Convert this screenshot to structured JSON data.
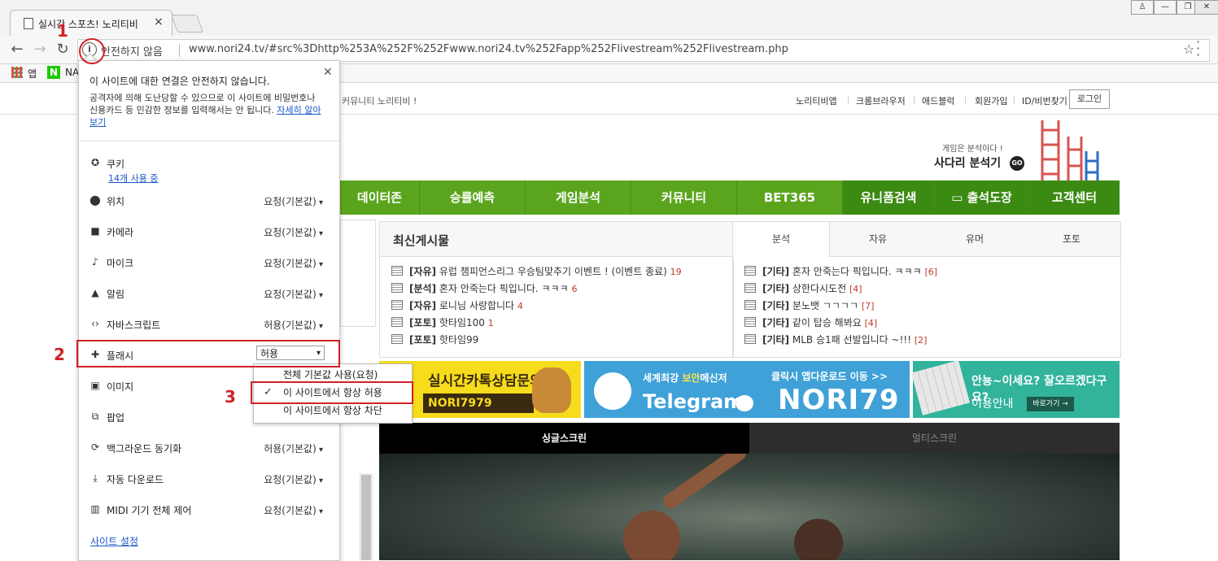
{
  "browser": {
    "tab_title": "실시간 스포츠! 노리티비",
    "tab_close": "×",
    "window_buttons": [
      "♙",
      "—",
      "❐",
      "✕"
    ],
    "security_label": "안전하지 않음",
    "url": "www.nori24.tv/#src%3Dhttp%253A%252F%252Fwww.nori24.tv%252Fapp%252Flivestream%252Flivestream.php",
    "bookmarks": [
      {
        "label": "앱",
        "icon": "apps-grid-icon"
      },
      {
        "label": "NA",
        "icon": "naver-icon"
      }
    ]
  },
  "popup": {
    "title": "이 사이트에 대한 연결은 안전하지 않습니다.",
    "description": "공격자에 의해 도난당할 수 있으므로 이 사이트에 비밀번호나 신용카드 등 민감한 정보를 입력해서는 안 됩니다.",
    "learn_more": "자세히 알아보기",
    "cookie": {
      "label": "쿠키",
      "link": "14개 사용 중"
    },
    "permissions": [
      {
        "label": "위치",
        "value": "요청(기본값)",
        "icon": "location-icon"
      },
      {
        "label": "카메라",
        "value": "요청(기본값)",
        "icon": "camera-icon"
      },
      {
        "label": "마이크",
        "value": "요청(기본값)",
        "icon": "microphone-icon"
      },
      {
        "label": "알림",
        "value": "요청(기본값)",
        "icon": "bell-icon"
      },
      {
        "label": "자바스크립트",
        "value": "허용(기본값)",
        "icon": "code-icon"
      },
      {
        "label": "플래시",
        "value": "허용",
        "icon": "puzzle-icon"
      },
      {
        "label": "이미지",
        "value": "",
        "icon": "image-icon"
      },
      {
        "label": "팝업",
        "value": "",
        "icon": "popup-blocked-icon"
      },
      {
        "label": "백그라운드 동기화",
        "value": "허용(기본값)",
        "icon": "sync-icon"
      },
      {
        "label": "자동 다운로드",
        "value": "요청(기본값)",
        "icon": "download-icon"
      },
      {
        "label": "MIDI 기기 전체 제어",
        "value": "요청(기본값)",
        "icon": "midi-icon"
      }
    ],
    "flash_options": [
      "전체 기본값 사용(요청)",
      "이 사이트에서 항상 허용",
      "이 사이트에서 항상 차단"
    ],
    "flash_selected_index": 1,
    "site_settings": "사이트 설정"
  },
  "annotations": [
    "1",
    "2",
    "3"
  ],
  "site": {
    "notice": "커뮤니티 노리티비 !",
    "top_links": [
      "노리티비앱",
      "크롬브라우저",
      "애드블럭",
      "회원가입",
      "ID/비번찾기"
    ],
    "login": "로그인",
    "ladder_slogan": "게임은 분석이다 !",
    "ladder_title": "사다리 분석기",
    "ladder_go": "GO",
    "nav": [
      "데이터존",
      "승률예측",
      "게임분석",
      "커뮤니티",
      "BET365",
      "유니폼검색",
      "출석도장",
      "고객센터"
    ],
    "latest_title": "최신게시물",
    "latest_posts": [
      {
        "cat": "[자유]",
        "text": "유럽 챔피언스리그 우승팀맞추기 이벤트 ! (이벤트 종료)",
        "count": "19"
      },
      {
        "cat": "[분석]",
        "text": "혼자 안죽는다 픽입니다. ㅋㅋㅋ",
        "count": "6"
      },
      {
        "cat": "[자유]",
        "text": "로니님 사랑합니다",
        "count": "4"
      },
      {
        "cat": "[포토]",
        "text": "핫타임100",
        "count": "1"
      },
      {
        "cat": "[포토]",
        "text": "핫타임99",
        "count": ""
      }
    ],
    "right_tabs": [
      "분석",
      "자유",
      "유머",
      "포토"
    ],
    "right_posts": [
      {
        "cat": "[기타]",
        "text": "혼자 안죽는다 픽입니다. ㅋㅋㅋ",
        "count": "[6]"
      },
      {
        "cat": "[기타]",
        "text": "상한다시도전",
        "count": "[4]"
      },
      {
        "cat": "[기타]",
        "text": "분노뱃 ㄱㄱㄱㄱ",
        "count": "[7]"
      },
      {
        "cat": "[기타]",
        "text": "같이 탑승 해봐요",
        "count": "[4]"
      },
      {
        "cat": "[기타]",
        "text": "MLB 승1패 선발입니다 ~!!!",
        "count": "[2]"
      }
    ],
    "banner_kakao": {
      "line1": "실시간카톡상담문의",
      "id": "NORI7979"
    },
    "banner_telegram": {
      "sub_pre": "세계최강",
      "sub_hl": "보안",
      "sub_post": "메신저",
      "name": "Telegram",
      "right_sub": "클릭시 앱다운로드 이동 >>",
      "right_id": "NORI79"
    },
    "banner_info": {
      "line1": "안뇽~이세요? 잘오르겠다구요?",
      "line2": "이용안내",
      "button": "바로가기 →"
    },
    "video_tabs": [
      "싱글스크린",
      "멀티스크린"
    ]
  }
}
